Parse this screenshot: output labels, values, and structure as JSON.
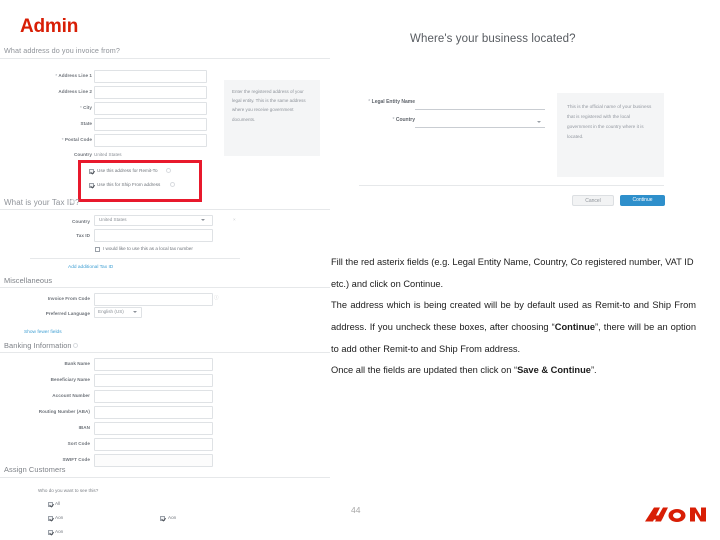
{
  "slide": {
    "title": "Admin",
    "page_number": "44",
    "brand": "AON",
    "brand_color": "#d81e05"
  },
  "left_screenshot": {
    "address_section": {
      "question": "What address do you invoice from?",
      "fields": [
        {
          "label": "Address Line 1",
          "required": true
        },
        {
          "label": "Address Line 2",
          "required": false
        },
        {
          "label": "City",
          "required": true
        },
        {
          "label": "State",
          "required": false
        },
        {
          "label": "Postal Code",
          "required": true
        }
      ],
      "country_label": "Country",
      "country_value": "United States",
      "help_text": "Enter the registered address of your legal entity. This is the same address where you receive government documents.",
      "checkboxes": [
        {
          "label": "Use this address for Remit-To",
          "checked": true
        },
        {
          "label": "Use this for Ship From address",
          "checked": true
        }
      ]
    },
    "tax_section": {
      "question": "What is your Tax ID?",
      "country_label": "Country",
      "country_value": "United States",
      "tax_id_label": "Tax ID",
      "no_tax_checkbox": "I would like to use this as a local tax number",
      "add_link": "Add additional Tax ID"
    },
    "misc_section": {
      "heading": "Miscellaneous",
      "invoice_from_label": "Invoice From Code",
      "preferred_language_label": "Preferred Language",
      "preferred_language_value": "English (US)",
      "show_fewer_link": "Show fewer fields"
    },
    "banking_section": {
      "heading": "Banking Information",
      "fields": [
        "Bank Name",
        "Beneficiary Name",
        "Account Number",
        "Routing Number (ABA)",
        "IBAN",
        "Sort Code",
        "SWIFT Code"
      ]
    },
    "assign_section": {
      "heading": "Assign Customers",
      "question": "Who do you want to see this?",
      "options": [
        {
          "label": "All",
          "checked": true
        },
        {
          "label": "Aon",
          "checked": true
        },
        {
          "label": "Aon",
          "checked": true
        },
        {
          "label": "Aon",
          "checked": true
        }
      ]
    }
  },
  "right_screenshot": {
    "title": "Where's your business located?",
    "legal_entity_label": "Legal Entity Name",
    "legal_entity_value": "",
    "country_label": "Country",
    "country_value": "",
    "help_text": "This is the official name of your business that is registered with the local government in the country where it is located.",
    "cancel_label": "Cancel",
    "continue_label": "Continue",
    "button_color": "#2e8fcb"
  },
  "instructions": {
    "p1": "Fill the red asterix fields (e.g. Legal Entity Name, Country, Co registered number, VAT ID etc.) and click on Continue.",
    "p2_a": "The address which is being created will be by default used as Remit-to and Ship From address. If you uncheck these boxes, after choosing ",
    "p2_b": "Continue",
    "p2_c": ", there will be an option to add other Remit-to and Ship From address.",
    "p3_a": "Once all the fields are updated then click on ",
    "p3_b": "Save & Continue",
    "p3_c": "."
  }
}
